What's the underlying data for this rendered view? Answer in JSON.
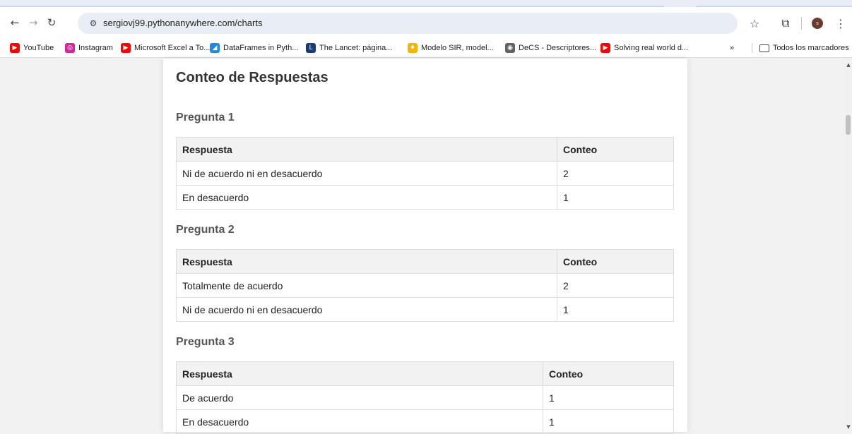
{
  "browser": {
    "url": "sergiovj99.pythonanywhere.com/charts",
    "avatar_initial": "s",
    "icons": {
      "back": "arrow-left-icon",
      "forward": "arrow-right-icon",
      "reload": "reload-icon",
      "site_info": "tune-icon",
      "star": "star-icon",
      "extensions": "puzzle-icon",
      "menu": "more-vert-icon"
    },
    "bookmarks": [
      {
        "label": "YouTube",
        "icon": "youtube-icon",
        "color": "#ff0000"
      },
      {
        "label": "Instagram",
        "icon": "instagram-icon",
        "color": "#d6249f"
      },
      {
        "label": "Microsoft Excel a To...",
        "icon": "youtube-icon",
        "color": "#ff0000"
      },
      {
        "label": "DataFrames in Pyth...",
        "icon": "datacamp-icon",
        "color": "#1e88e5"
      },
      {
        "label": "The Lancet: página...",
        "icon": "lancet-icon",
        "color": "#1a3b7a"
      },
      {
        "label": "Modelo SIR, model...",
        "icon": "flame-icon",
        "color": "#f4b400"
      },
      {
        "label": "DeCS - Descriptores...",
        "icon": "globe-icon",
        "color": "#5f6368"
      },
      {
        "label": "Solving real world d...",
        "icon": "youtube-icon",
        "color": "#ff0000"
      }
    ],
    "bookmarks_overflow": "»",
    "all_bookmarks_label": "Todos los marcadores"
  },
  "page": {
    "title": "Conteo de Respuestas",
    "questions": [
      {
        "title": "Pregunta 1",
        "headers": [
          "Respuesta",
          "Conteo"
        ],
        "rows": [
          [
            "Ni de acuerdo ni en desacuerdo",
            "2"
          ],
          [
            "En desacuerdo",
            "1"
          ]
        ]
      },
      {
        "title": "Pregunta 2",
        "headers": [
          "Respuesta",
          "Conteo"
        ],
        "rows": [
          [
            "Totalmente de acuerdo",
            "2"
          ],
          [
            "Ni de acuerdo ni en desacuerdo",
            "1"
          ]
        ]
      },
      {
        "title": "Pregunta 3",
        "headers": [
          "Respuesta",
          "Conteo"
        ],
        "rows": [
          [
            "De acuerdo",
            "1"
          ],
          [
            "En desacuerdo",
            "1"
          ]
        ]
      }
    ]
  }
}
